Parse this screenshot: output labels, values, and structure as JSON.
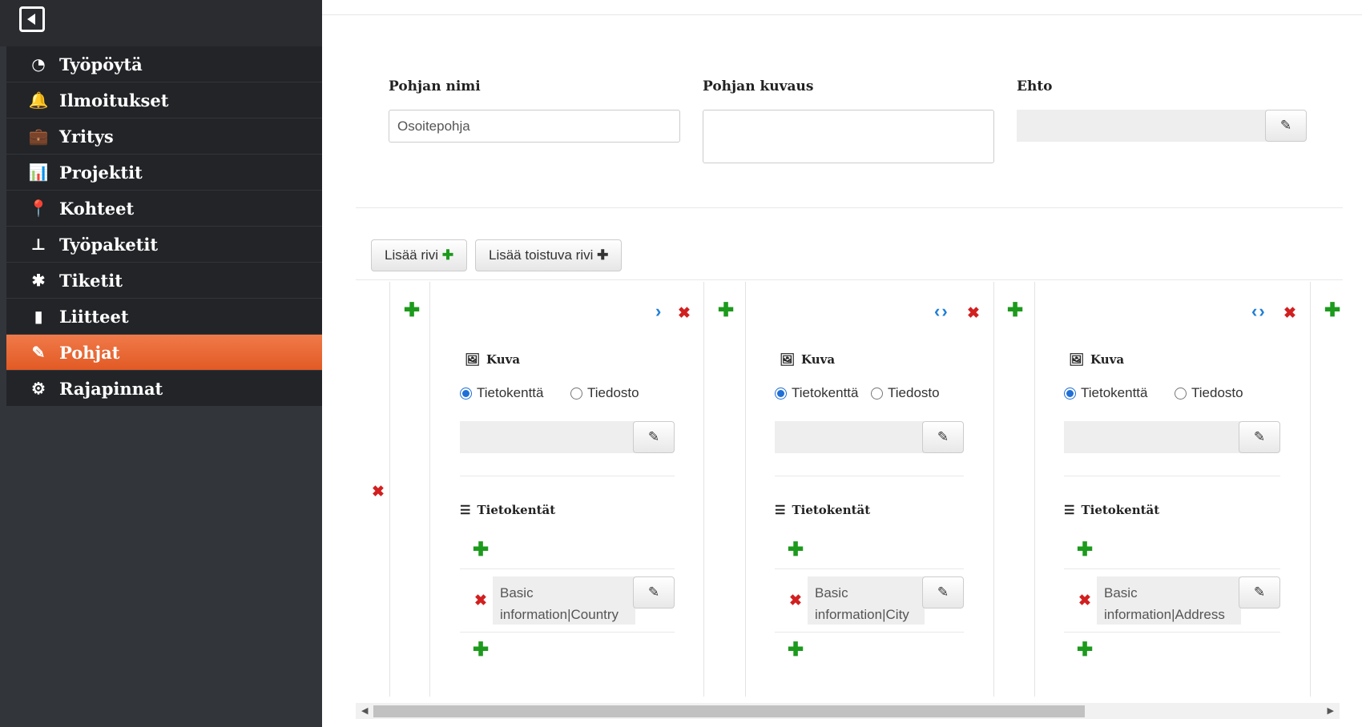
{
  "nav": {
    "items": [
      {
        "label": "Työpöytä",
        "icon": "dashboard-icon",
        "glyph": "◔"
      },
      {
        "label": "Ilmoitukset",
        "icon": "bell-icon",
        "glyph": "🔔"
      },
      {
        "label": "Yritys",
        "icon": "briefcase-icon",
        "glyph": "💼"
      },
      {
        "label": "Projektit",
        "icon": "bar-chart-icon",
        "glyph": "📊"
      },
      {
        "label": "Kohteet",
        "icon": "map-marker-icon",
        "glyph": "📍"
      },
      {
        "label": "Työpaketit",
        "icon": "sitemap-icon",
        "glyph": "⊥"
      },
      {
        "label": "Tiketit",
        "icon": "bug-icon",
        "glyph": "✱"
      },
      {
        "label": "Liitteet",
        "icon": "file-icon",
        "glyph": "▮"
      },
      {
        "label": "Pohjat",
        "icon": "pencil-icon",
        "glyph": "✎",
        "active": true
      },
      {
        "label": "Rajapinnat",
        "icon": "cogs-icon",
        "glyph": "⚙"
      }
    ]
  },
  "form": {
    "name_label": "Pohjan nimi",
    "name_value": "Osoitepohja",
    "description_label": "Pohjan kuvaus",
    "description_value": "",
    "condition_label": "Ehto"
  },
  "toolbar": {
    "add_row_label": "Lisää rivi",
    "add_repeating_row_label": "Lisää toistuva rivi"
  },
  "columns": [
    {
      "image_title": "Kuva",
      "radio_field": "Tietokenttä",
      "radio_file": "Tiedosto",
      "fields_title": "Tietokentät",
      "field_value": "Basic information|Country",
      "field_line1": "Basic",
      "field_line2": "information|Country"
    },
    {
      "image_title": "Kuva",
      "radio_field": "Tietokenttä",
      "radio_file": "Tiedosto",
      "fields_title": "Tietokentät",
      "field_value": "Basic information|City",
      "field_line1": "Basic",
      "field_line2": "information|City"
    },
    {
      "image_title": "Kuva",
      "radio_field": "Tietokenttä",
      "radio_file": "Tiedosto",
      "fields_title": "Tietokentät",
      "field_value": "Basic information|Address",
      "field_line1": "Basic",
      "field_line2": "information|Address"
    }
  ],
  "colors": {
    "sidebar_bg": "#32353a",
    "active_nav": "#e8642f",
    "add_green": "#1c9a1c",
    "remove_red": "#d21f1f",
    "move_blue": "#1f7fd6"
  }
}
